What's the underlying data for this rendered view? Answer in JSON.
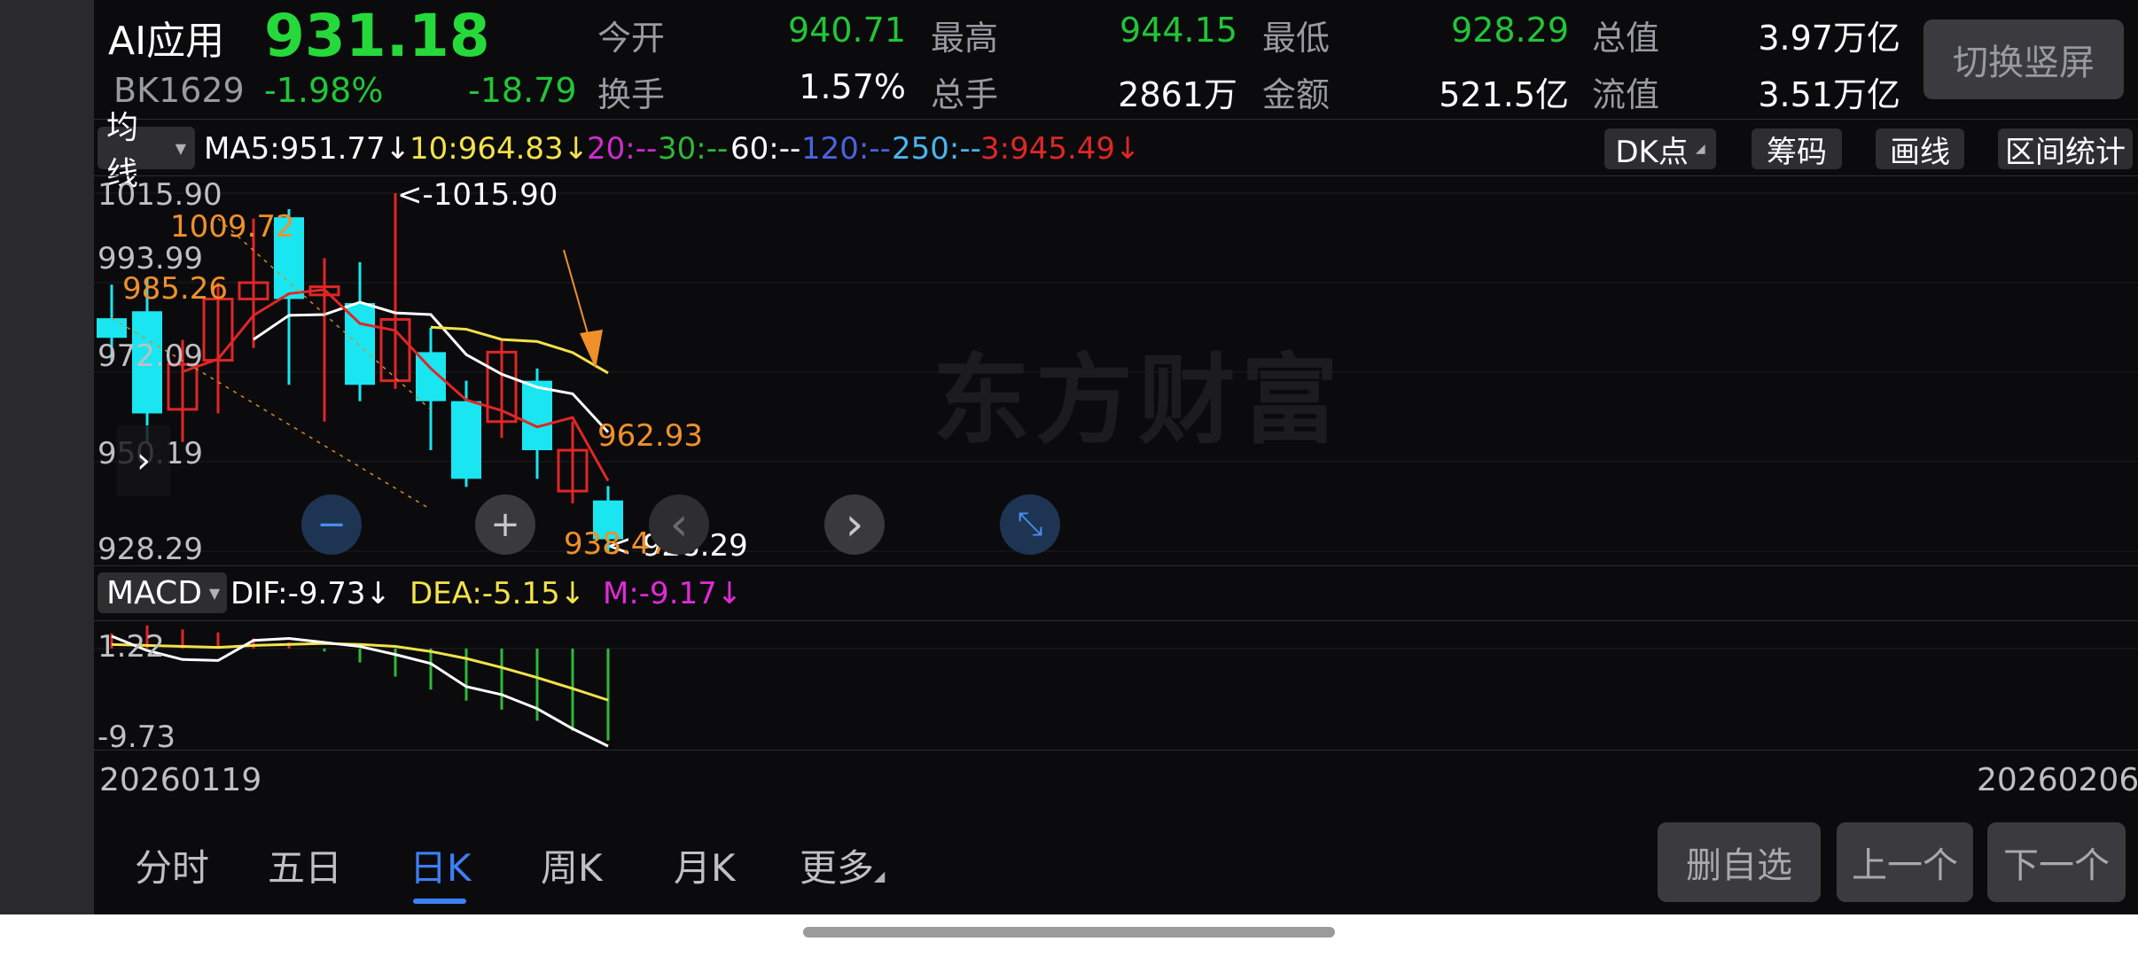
{
  "header": {
    "title": "AI应用",
    "price": "931.18",
    "code": "BK1629",
    "change_pct": "-1.98%",
    "change_abs": "-18.79",
    "stats": [
      {
        "label": "今开",
        "value": "940.71"
      },
      {
        "label": "最高",
        "value": "944.15"
      },
      {
        "label": "最低",
        "value": "928.29"
      },
      {
        "label": "总值",
        "value": "3.97万亿"
      },
      {
        "label": "换手",
        "value": "1.57%"
      },
      {
        "label": "总手",
        "value": "2861万"
      },
      {
        "label": "金额",
        "value": "521.5亿"
      },
      {
        "label": "流值",
        "value": "3.51万亿"
      }
    ],
    "switch_label": "切换竖屏"
  },
  "indicator": {
    "selector": "均线",
    "ma": [
      {
        "text": "MA5:951.77↓",
        "color": "#ffffff"
      },
      {
        "text": "10:964.83↓",
        "color": "#f3e24a"
      },
      {
        "text": "20:--",
        "color": "#d12bd1"
      },
      {
        "text": "30:--",
        "color": "#2eb83a"
      },
      {
        "text": "60:--",
        "color": "#ffffff"
      },
      {
        "text": "120:--",
        "color": "#4a63e0"
      },
      {
        "text": "250:--",
        "color": "#4ab5f0"
      },
      {
        "text": "3:945.49↓",
        "color": "#e02626"
      }
    ],
    "tools": [
      "DK点",
      "筹码",
      "画线",
      "区间统计"
    ]
  },
  "price_axis": [
    "1015.90",
    "993.99",
    "972.09",
    "950.19",
    "928.29"
  ],
  "annotations": {
    "high": "<-1015.90",
    "low": "<-928.29",
    "orange": [
      "1009.72",
      "985.26",
      "962.93",
      "938.47"
    ]
  },
  "watermark": "东方财富",
  "macd": {
    "selector": "MACD",
    "dif": "DIF:-9.73↓",
    "dea": "DEA:-5.15↓",
    "m": "M:-9.17↓",
    "axis": [
      "1.22",
      "-9.73"
    ]
  },
  "dates": {
    "start": "20260119",
    "end": "20260206"
  },
  "tabs": [
    {
      "label": "分时",
      "active": false
    },
    {
      "label": "五日",
      "active": false
    },
    {
      "label": "日K",
      "active": true
    },
    {
      "label": "周K",
      "active": false
    },
    {
      "label": "月K",
      "active": false
    },
    {
      "label": "更多",
      "active": false
    }
  ],
  "bottom_buttons": [
    "删自选",
    "上一个",
    "下一个"
  ],
  "controls": {
    "zoom_out": "−",
    "zoom_in": "+",
    "prev": "‹",
    "next": "›",
    "collapse": "⤡",
    "rail_toggle": "›"
  },
  "colors": {
    "up": "#e02626",
    "down": "#19e6f0",
    "green": "#22c538",
    "accent": "#3d7ff5"
  },
  "chart_data": [
    {
      "type": "candlestick",
      "title": "",
      "candles": [
        {
          "open": 985.3,
          "close": 980.5,
          "high": 993.5,
          "low": 975.0
        },
        {
          "open": 987.0,
          "close": 962.0,
          "high": 995.0,
          "low": 955.0
        },
        {
          "open": 963.0,
          "close": 974.0,
          "high": 980.0,
          "low": 955.0
        },
        {
          "open": 975.0,
          "close": 990.0,
          "high": 994.0,
          "low": 962.0
        },
        {
          "open": 990.0,
          "close": 994.0,
          "high": 1009.7,
          "low": 978.0
        },
        {
          "open": 1010.0,
          "close": 990.0,
          "high": 1012.0,
          "low": 969.0
        },
        {
          "open": 991.0,
          "close": 993.0,
          "high": 1000.0,
          "low": 960.0
        },
        {
          "open": 989.0,
          "close": 969.0,
          "high": 999.0,
          "low": 965.0
        },
        {
          "open": 970.0,
          "close": 985.0,
          "high": 1015.9,
          "low": 968.0
        },
        {
          "open": 977.0,
          "close": 965.0,
          "high": 983.0,
          "low": 953.0
        },
        {
          "open": 965.0,
          "close": 946.0,
          "high": 970.0,
          "low": 944.0
        },
        {
          "open": 960.0,
          "close": 977.0,
          "high": 980.0,
          "low": 956.0
        },
        {
          "open": 970.0,
          "close": 953.0,
          "high": 973.0,
          "low": 946.0
        },
        {
          "open": 943.0,
          "close": 953.0,
          "high": 960.0,
          "low": 940.0
        },
        {
          "open": 940.7,
          "close": 931.2,
          "high": 944.2,
          "low": 928.3
        }
      ],
      "ma": [
        {
          "name": "MA5",
          "color": "#ffffff",
          "values": [
            null,
            null,
            null,
            null,
            980.1,
            986.0,
            986.2,
            989.2,
            986.6,
            986.2,
            976.4,
            971.6,
            968.4,
            966.8,
            957.4
          ]
        },
        {
          "name": "MA10",
          "color": "#f3e24a",
          "values": [
            null,
            null,
            null,
            null,
            null,
            null,
            null,
            null,
            null,
            983.1,
            982.6,
            980.1,
            979.6,
            976.9,
            971.9
          ]
        },
        {
          "name": "MA3",
          "color": "#e02626",
          "values": [
            null,
            null,
            972.2,
            975.3,
            986.0,
            991.3,
            992.3,
            984.0,
            982.3,
            973.0,
            965.3,
            962.7,
            958.7,
            961.0,
            945.5
          ]
        }
      ],
      "ylim": [
        928.29,
        1015.9
      ]
    },
    {
      "type": "bar",
      "title": "MACD",
      "bars": [
        1.5,
        2.3,
        1.9,
        1.6,
        1.0,
        0.6,
        -0.3,
        -1.4,
        -2.8,
        -4.1,
        -5.2,
        -6.1,
        -7.2,
        -8.2,
        -9.17
      ],
      "dif": [
        1.22,
        -0.2,
        -1.1,
        -1.2,
        0.8,
        1.0,
        0.6,
        0.2,
        -0.6,
        -1.5,
        -3.8,
        -4.6,
        -6.0,
        -8.0,
        -9.73
      ],
      "dea": [
        0.4,
        0.3,
        0.2,
        0.1,
        0.3,
        0.4,
        0.5,
        0.4,
        0.2,
        -0.3,
        -1.0,
        -1.9,
        -2.9,
        -4.0,
        -5.15
      ],
      "ylim": [
        -9.73,
        1.22
      ]
    }
  ]
}
